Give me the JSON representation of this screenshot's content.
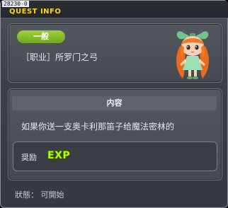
{
  "window": {
    "id": "28230-0",
    "title": "QUEST INFO"
  },
  "quest": {
    "badge": "一般",
    "name": "［职业］所罗门之弓"
  },
  "content": {
    "header": "内容",
    "description": "如果你送一支奥卡利那笛子给魔法密林的",
    "reward_label": "奨励",
    "reward_type": "EXP"
  },
  "status": "狀態： 可開始",
  "colors": {
    "title": "#ffd700",
    "badge": "#8cc72e",
    "exp": "#b6ff00"
  },
  "icons": {
    "npc": "fairy-girl-icon"
  }
}
